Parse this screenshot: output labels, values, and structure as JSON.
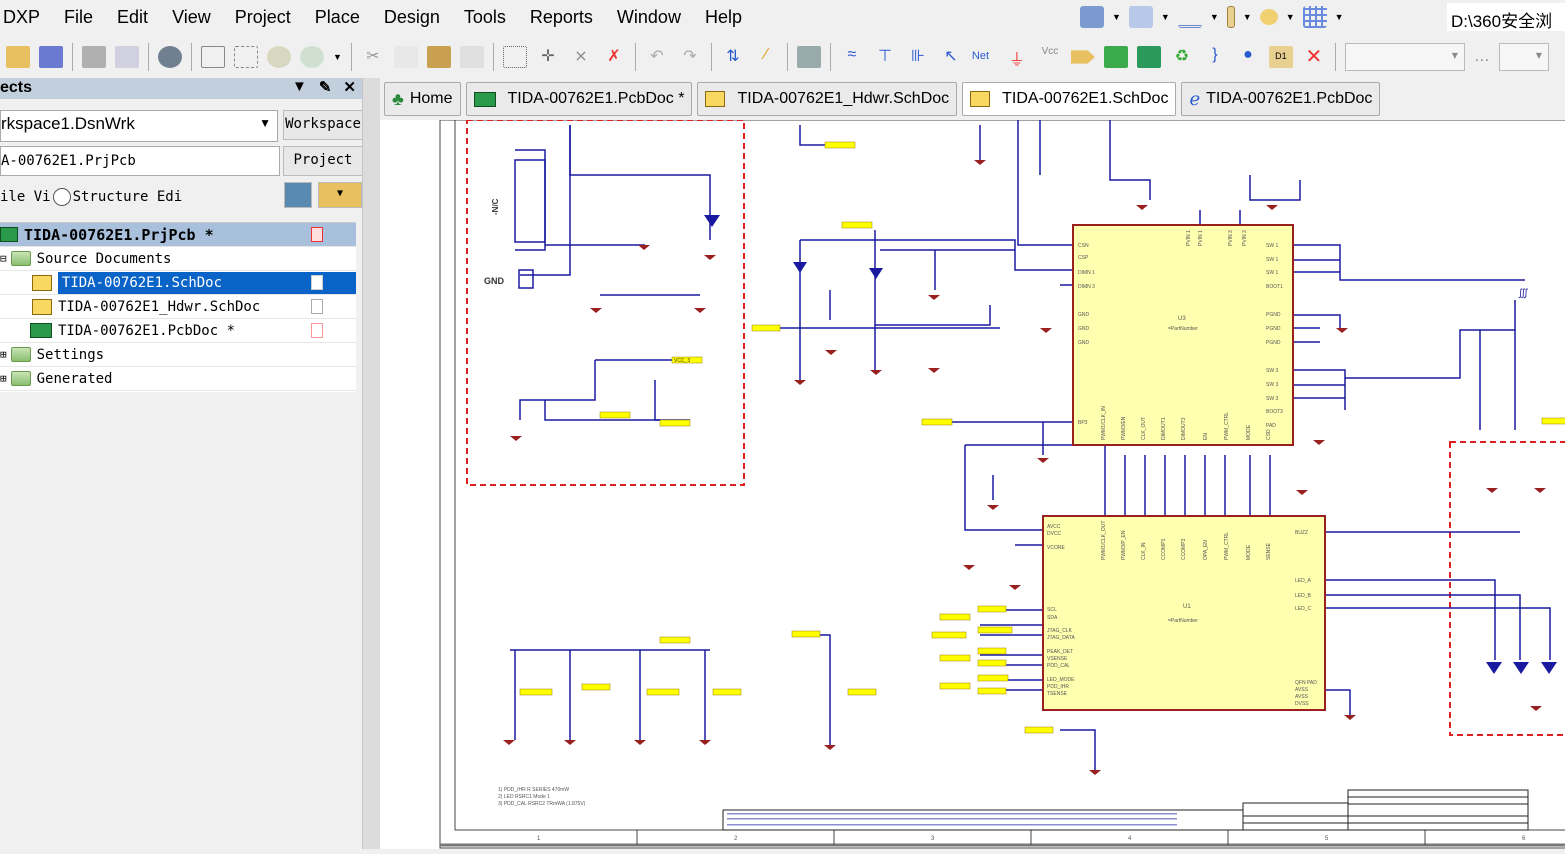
{
  "menu": [
    "DXP",
    "File",
    "Edit",
    "View",
    "Project",
    "Place",
    "Design",
    "Tools",
    "Reports",
    "Window",
    "Help"
  ],
  "right_toolbar": {
    "path": "D:\\360安全浏"
  },
  "panel": {
    "title": "ects",
    "workspace_value": "rkspace1.DsnWrk",
    "workspace_button": "Workspace",
    "project_value": "A-00762E1.PrjPcb",
    "project_button": "Project",
    "view_option_file": "ile Vi",
    "view_option_structure": "Structure Edi",
    "tree": [
      {
        "label": "TIDA-00762E1.PrjPcb *",
        "level": 0,
        "type": "project",
        "selected": false,
        "highlight": true
      },
      {
        "label": "Source Documents",
        "level": 1,
        "type": "folder",
        "expanded": true
      },
      {
        "label": "TIDA-00762E1.SchDoc",
        "level": 2,
        "type": "sch",
        "selected": true
      },
      {
        "label": "TIDA-00762E1_Hdwr.SchDoc",
        "level": 2,
        "type": "sch"
      },
      {
        "label": "TIDA-00762E1.PcbDoc *",
        "level": 2,
        "type": "pcb"
      },
      {
        "label": "Settings",
        "level": 1,
        "type": "folder",
        "expanded": false
      },
      {
        "label": "Generated",
        "level": 1,
        "type": "folder",
        "expanded": false
      }
    ]
  },
  "tabs": [
    {
      "label": "Home",
      "icon": "home-icon"
    },
    {
      "label": "TIDA-00762E1.PcbDoc *",
      "icon": "pcb-icon"
    },
    {
      "label": "TIDA-00762E1_Hdwr.SchDoc",
      "icon": "schematic-icon"
    },
    {
      "label": "TIDA-00762E1.SchDoc",
      "icon": "schematic-icon",
      "active": true
    },
    {
      "label": "TIDA-00762E1.PcbDoc",
      "icon": "browser-icon"
    }
  ],
  "schematic": {
    "colors": {
      "wire": "#1a1aa0",
      "component": "#9a2020",
      "ic_fill": "#ffffb0",
      "net_label": "#ffff00",
      "border_dash": "#e02020"
    },
    "u3": {
      "designator": "U3",
      "comment": "=PartNumber",
      "left_pins": [
        "CSN",
        "CSP",
        "DIMN 1",
        "DIMN 3",
        "GND",
        "GND",
        "GND",
        "BP3"
      ],
      "right_pins": [
        "SW 1",
        "SW 1",
        "SW 1",
        "BOOT1",
        "PGND",
        "PGND",
        "PGND",
        "SW 3",
        "SW 3",
        "SW 3",
        "BOOT3",
        "PAD"
      ],
      "top_pins": [
        "PVIN 1",
        "PVIN 1",
        "PVIN 3",
        "PVIN 3"
      ],
      "bottom_pins": [
        "PWM1/CLK_IN",
        "PWM3/EN",
        "CLK_OUT",
        "DIMOUT1",
        "DIMOUT3",
        "EN",
        "PWM_CTRL",
        "MODE",
        "CSD"
      ]
    },
    "u1": {
      "designator": "U1",
      "comment": "=PartNumber",
      "left_pins": [
        "AVCC",
        "DVCC",
        "VCORE",
        "SCL",
        "SDA",
        "JTAG_CLK",
        "JTAG_DATA",
        "PEAK_DET",
        "VSENSE",
        "PDD_CAL",
        "LED_MODE",
        "PDD_IHR",
        "TSENSE"
      ],
      "right_pins": [
        "BUZZ",
        "LED_A",
        "LED_B",
        "LED_C",
        "QFN PAD",
        "AVSS",
        "AVSS",
        "DVSS"
      ],
      "top_pins": [
        "PWM1/CLK_OUT",
        "PWM3/P_EN",
        "CLK_IN",
        "CCOMP1",
        "CCOMP3",
        "OPA_EN",
        "PWM_CTRL",
        "MODE",
        "SENSE"
      ]
    },
    "labels": {
      "gnd": "GND",
      "nc": "-N/C",
      "pgnd": "PGND",
      "vcc": "VCC_3"
    },
    "notes": [
      "1) PDD_IHR R SERIES 470mW",
      "2) LED RSRC1 Mode 1",
      "3) PDD_CAL RSRC2 TRmWA (1.875V)"
    ],
    "ruler": [
      "1",
      "2",
      "3",
      "4",
      "5",
      "6"
    ]
  }
}
